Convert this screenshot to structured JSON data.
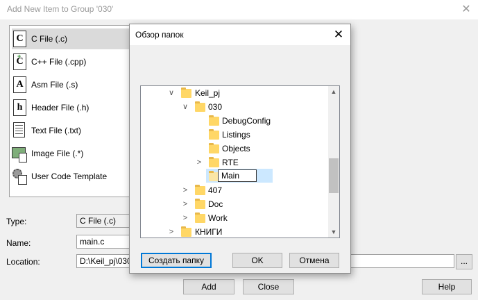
{
  "outer": {
    "title": "Add New Item to Group '030'",
    "close_glyph": "✕",
    "templates": [
      {
        "label": "C File (.c)",
        "icon": "c-file-icon",
        "letter": "C"
      },
      {
        "label": "C++ File (.cpp)",
        "icon": "cpp-file-icon",
        "letter": "C"
      },
      {
        "label": "Asm File (.s)",
        "icon": "asm-file-icon",
        "letter": "A"
      },
      {
        "label": "Header File (.h)",
        "icon": "header-file-icon",
        "letter": "h"
      },
      {
        "label": "Text File (.txt)",
        "icon": "text-file-icon",
        "letter": ""
      },
      {
        "label": "Image File (.*)",
        "icon": "image-file-icon",
        "letter": ""
      },
      {
        "label": "User Code Template",
        "icon": "user-code-template-icon",
        "letter": ""
      }
    ],
    "type_label": "Type:",
    "type_value": "C File (.c)",
    "name_label": "Name:",
    "name_value": "main.c",
    "location_label": "Location:",
    "location_value": "D:\\Keil_pj\\030",
    "browse_label": "...",
    "add_label": "Add",
    "close_label": "Close",
    "help_label": "Help"
  },
  "folder_dialog": {
    "title": "Обзор папок",
    "close_glyph": "✕",
    "tree": [
      {
        "label": "Keil_pj",
        "chevron": "∨"
      },
      {
        "label": "030",
        "chevron": "∨"
      },
      {
        "label": "DebugConfig",
        "chevron": ""
      },
      {
        "label": "Listings",
        "chevron": ""
      },
      {
        "label": "Objects",
        "chevron": ""
      },
      {
        "label": "RTE",
        "chevron": ">"
      },
      {
        "label": "Main",
        "chevron": ""
      },
      {
        "label": "407",
        "chevron": ">"
      },
      {
        "label": "Doc",
        "chevron": ">"
      },
      {
        "label": "Work",
        "chevron": ">"
      },
      {
        "label": "КНИГИ",
        "chevron": ">"
      }
    ],
    "scroll_up_glyph": "▲",
    "scroll_down_glyph": "▼",
    "new_folder_label": "Создать папку",
    "ok_label": "OK",
    "cancel_label": "Отмена"
  },
  "colors": {
    "selection": "#cce8ff",
    "folder": "#ffd766",
    "accent_border": "#0078d7"
  }
}
